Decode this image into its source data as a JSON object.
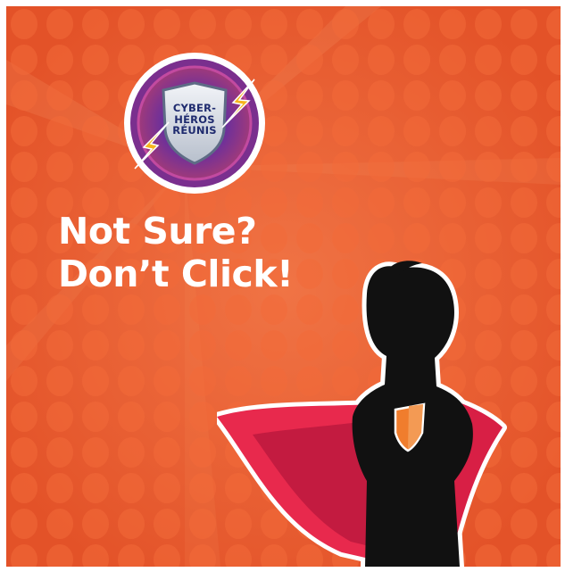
{
  "logo": {
    "line1": "CYBER-",
    "line2": "HÉROS",
    "line3": "RÉUNIS",
    "icon": "shield-lightning-badge"
  },
  "headline": {
    "line1": "Not Sure?",
    "line2": "Don’t Click!"
  },
  "colors": {
    "background": "#e8592c",
    "text": "#ffffff",
    "cape": "#e8294d",
    "silhouette": "#111111",
    "emblem": "#f07d2d"
  }
}
